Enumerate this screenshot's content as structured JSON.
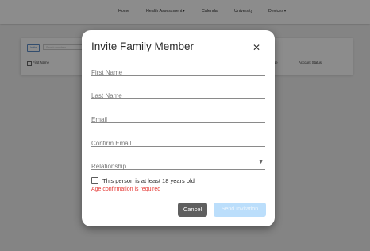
{
  "nav": {
    "items": [
      {
        "label": "Home",
        "dropdown": false
      },
      {
        "label": "Health Assessment",
        "dropdown": true
      },
      {
        "label": "Calendar",
        "dropdown": false
      },
      {
        "label": "University",
        "dropdown": false
      },
      {
        "label": "Devices",
        "dropdown": true
      }
    ]
  },
  "background": {
    "invite_label": "Invite",
    "search_placeholder": "Search members",
    "columns": [
      "First Name",
      "Age",
      "Account Status"
    ]
  },
  "modal": {
    "title": "Invite Family Member",
    "close_icon": "close-icon",
    "fields": {
      "first_name": {
        "placeholder": "First Name",
        "value": ""
      },
      "last_name": {
        "placeholder": "Last Name",
        "value": ""
      },
      "email": {
        "placeholder": "Email",
        "value": ""
      },
      "confirm_email": {
        "placeholder": "Confirm Email",
        "value": ""
      },
      "relationship": {
        "placeholder": "Relationship",
        "value": ""
      }
    },
    "age_checkbox_label": "This person is at least 18 years old",
    "age_checked": false,
    "error_text": "Age confirmation is required",
    "cancel_label": "Cancel",
    "send_label": "Send Invitation",
    "send_disabled": true
  },
  "colors": {
    "error": "#e53935",
    "cancel_bg": "#5f5f5f",
    "send_disabled_bg": "#bbdefb",
    "overlay": "rgba(0,0,0,0.45)"
  }
}
